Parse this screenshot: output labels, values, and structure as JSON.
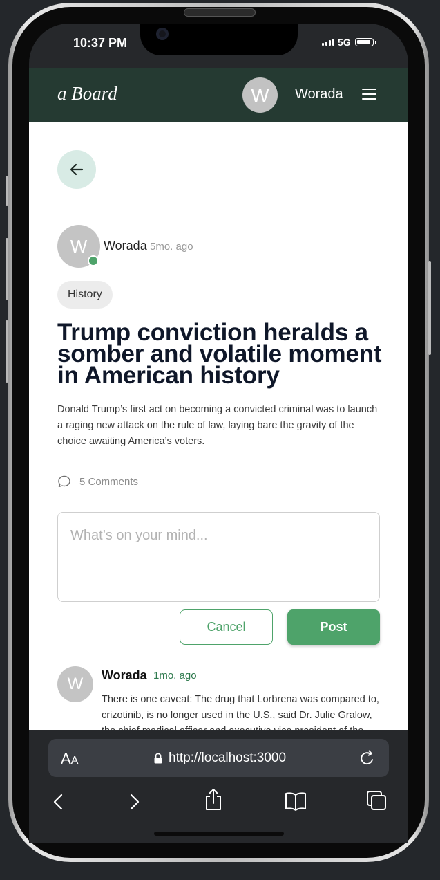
{
  "status_bar": {
    "time": "10:37 PM",
    "network": "5G"
  },
  "header": {
    "logo": "a Board",
    "avatar_initial": "W",
    "username": "Worada"
  },
  "post": {
    "avatar_initial": "W",
    "author": "Worada",
    "time_ago": "5mo. ago",
    "tag": "History",
    "title": "Trump conviction heralds a somber and volatile moment in American history",
    "body": "Donald Trump’s first act on becoming a convicted criminal was to launch a raging new attack on the rule of law, laying bare the gravity of the choice awaiting America’s voters.",
    "comments_label": "5 Comments"
  },
  "comment_form": {
    "placeholder": "What’s on your mind...",
    "cancel_label": "Cancel",
    "post_label": "Post"
  },
  "comments": [
    {
      "avatar_initial": "W",
      "author": "Worada",
      "time_ago": "1mo. ago",
      "text": "There is one caveat: The drug that Lorbrena was compared to, crizotinib, is no longer used in the U.S., said Dr. Julie Gralow, the chief medical officer and executive vice president of the American Society of Clinical Oncology."
    }
  ],
  "browser": {
    "text_size_label_big": "A",
    "text_size_label_small": "A",
    "url": "http://localhost:3000"
  },
  "colors": {
    "header_bg": "#253a32",
    "accent_green": "#4ea36a",
    "back_button_bg": "#d8ebe5",
    "title_color": "#0f1729"
  },
  "icons": {
    "back": "arrow-left-icon",
    "menu": "hamburger-menu-icon",
    "comments": "speech-bubble-icon",
    "lock": "lock-icon",
    "reload": "reload-icon",
    "browser_back": "chevron-left-icon",
    "browser_forward": "chevron-right-icon",
    "share": "share-icon",
    "bookmarks": "book-icon",
    "tabs": "tabs-icon"
  }
}
